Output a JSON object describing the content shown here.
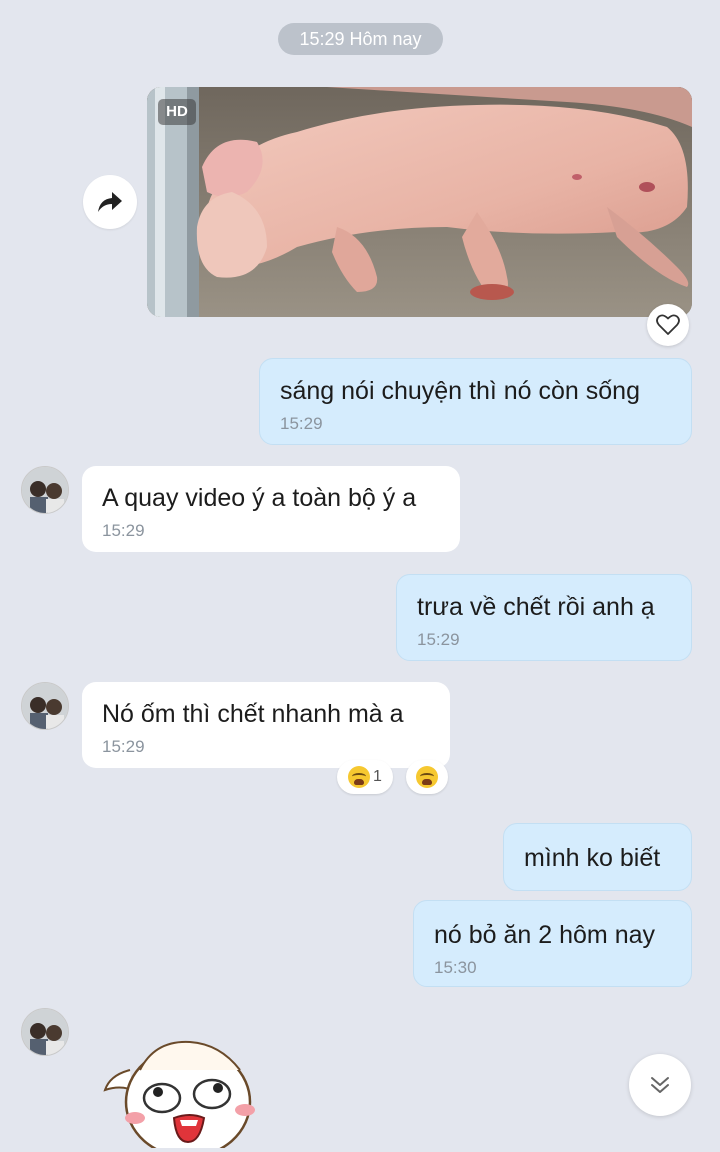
{
  "date_separator": "15:29 Hôm nay",
  "image_message": {
    "badge": "HD",
    "share_icon": "share-arrow-icon",
    "like_icon": "heart-outline-icon"
  },
  "messages": [
    {
      "sender": "me",
      "text": "sáng nói chuyện thì nó còn sống",
      "time": "15:29"
    },
    {
      "sender": "them",
      "text": "A quay video ý a toàn bộ ý a",
      "time": "15:29"
    },
    {
      "sender": "me",
      "text": "trưa về chết rồi anh ạ",
      "time": "15:29"
    },
    {
      "sender": "them",
      "text": "Nó ốm thì chết nhanh mà a",
      "time": "15:29",
      "reactions": {
        "count": "1",
        "icon": "crying-face-emoji"
      }
    },
    {
      "sender": "me",
      "text": "mình ko biết",
      "time": ""
    },
    {
      "sender": "me",
      "text": "nó bỏ ăn 2 hôm nay",
      "time": "15:30"
    }
  ],
  "scroll_down_icon": "double-chevron-down-icon",
  "colors": {
    "background": "#e3e6ee",
    "outgoing_bubble": "#d5ecfd",
    "incoming_bubble": "#ffffff",
    "timestamp": "#8b949e"
  }
}
